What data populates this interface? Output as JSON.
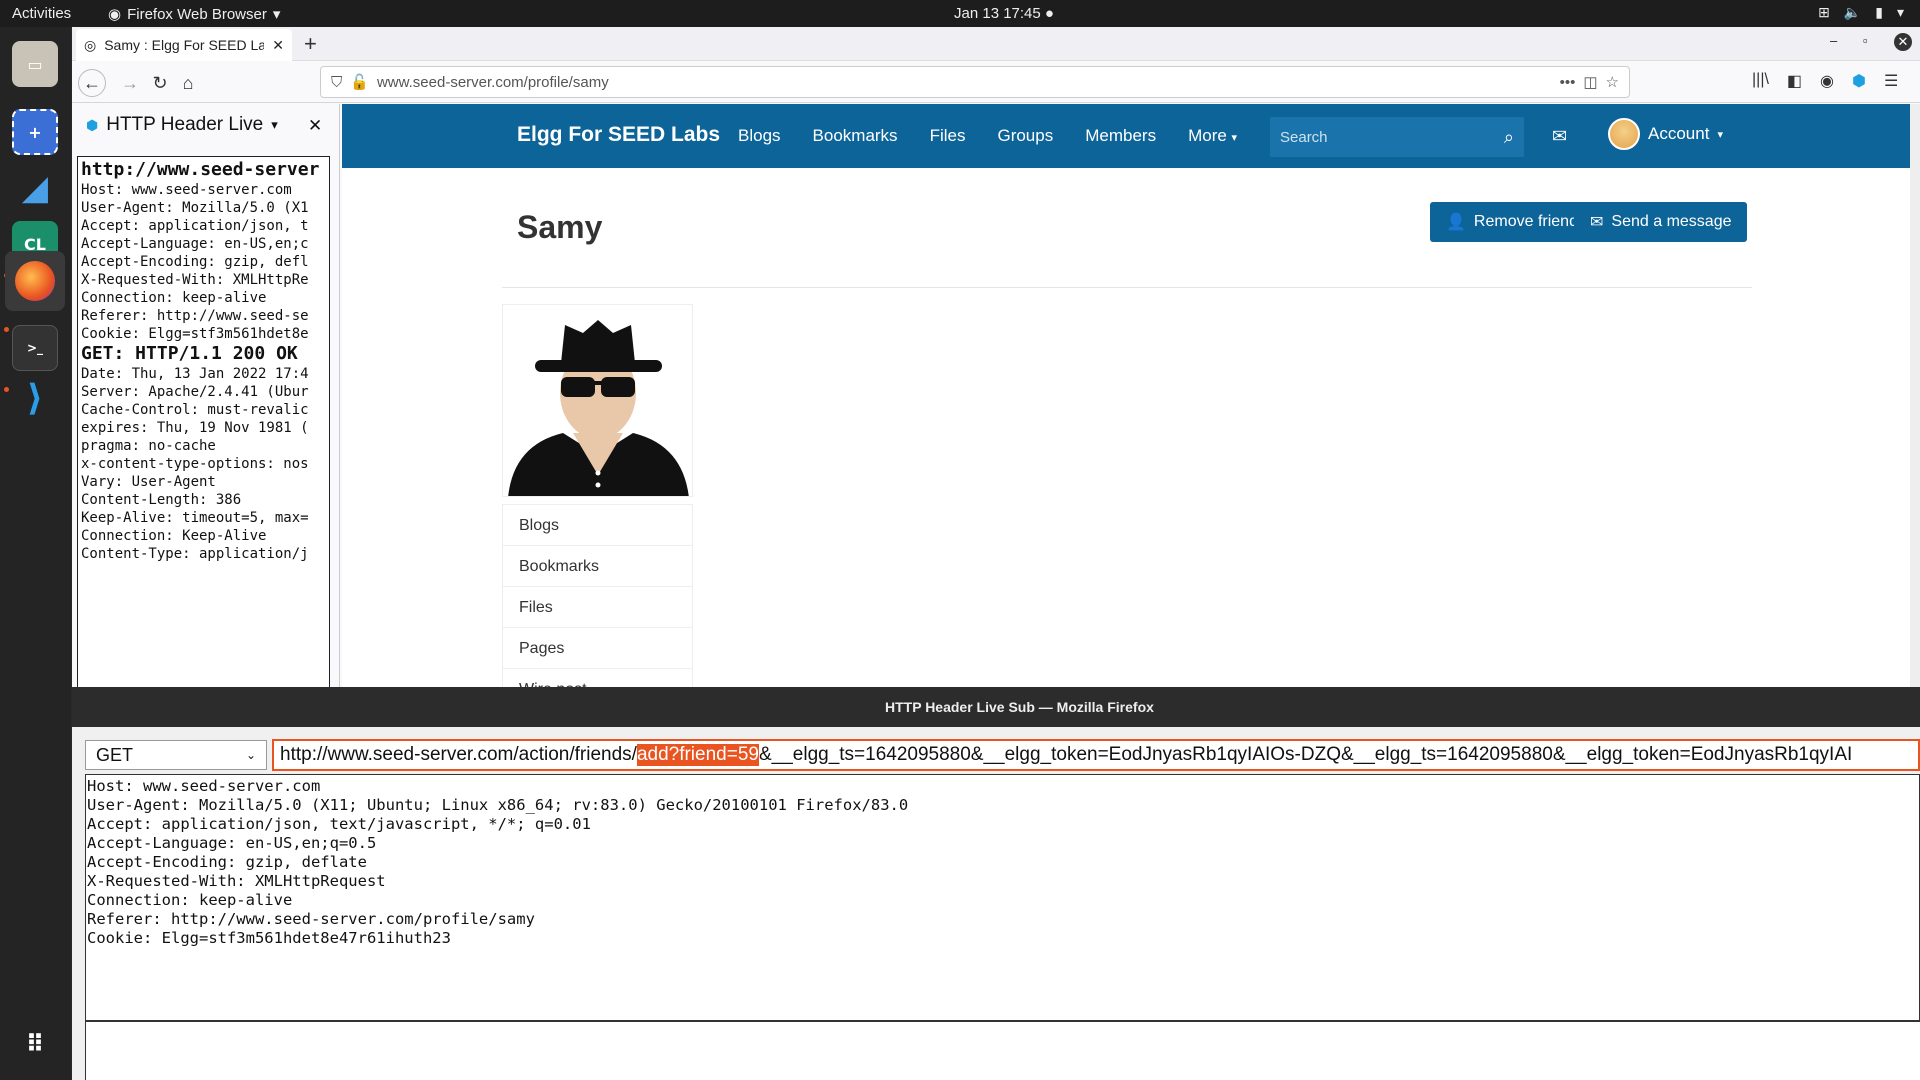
{
  "topbar": {
    "activities": "Activities",
    "app_name": "Firefox Web Browser",
    "clock": "Jan 13  17:45"
  },
  "tab": {
    "title": "Samy : Elgg For SEED Lab"
  },
  "urlbar": {
    "url": "www.seed-server.com/profile/samy"
  },
  "sidebar": {
    "title": "HTTP Header Live",
    "request_url": "http://www.seed-server",
    "request_lines": [
      "Host: www.seed-server.com",
      "User-Agent: Mozilla/5.0 (X1",
      "Accept: application/json, t",
      "Accept-Language: en-US,en;c",
      "Accept-Encoding: gzip, defl",
      "X-Requested-With: XMLHttpRe",
      "Connection: keep-alive",
      "Referer: http://www.seed-se",
      "Cookie: Elgg=stf3m561hdet8e"
    ],
    "status_line": "GET: HTTP/1.1 200 OK",
    "response_lines": [
      "Date: Thu, 13 Jan 2022 17:4",
      "Server: Apache/2.4.41 (Ubur",
      "Cache-Control: must-revalic",
      "expires: Thu, 19 Nov 1981 (",
      "pragma: no-cache",
      "x-content-type-options: nos",
      "Vary: User-Agent",
      "Content-Length: 386",
      "Keep-Alive: timeout=5, max=",
      "Connection: Keep-Alive",
      "Content-Type: application/j"
    ]
  },
  "elgg": {
    "brand": "Elgg For SEED Labs",
    "menu": [
      "Blogs",
      "Bookmarks",
      "Files",
      "Groups",
      "Members",
      "More"
    ],
    "search_placeholder": "Search",
    "account": "Account",
    "profile_name": "Samy",
    "remove_friend": "Remove friend",
    "send_message": "Send a message",
    "owner_menu": [
      "Blogs",
      "Bookmarks",
      "Files",
      "Pages",
      "Wire post"
    ]
  },
  "subwindow": {
    "title": "HTTP Header Live Sub — Mozilla Firefox",
    "method": "GET",
    "url_prefix": "http://www.seed-server.com/action/friends/",
    "url_highlight": "add?friend=59",
    "url_suffix": "&__elgg_ts=1642095880&__elgg_token=EodJnyasRb1qyIAIOs-DZQ&__elgg_ts=1642095880&__elgg_token=EodJnyasRb1qyIAI",
    "headers": "Host: www.seed-server.com\nUser-Agent: Mozilla/5.0 (X11; Ubuntu; Linux x86_64; rv:83.0) Gecko/20100101 Firefox/83.0\nAccept: application/json, text/javascript, */*; q=0.01\nAccept-Language: en-US,en;q=0.5\nAccept-Encoding: gzip, deflate\nX-Requested-With: XMLHttpRequest\nConnection: keep-alive\nReferer: http://www.seed-server.com/profile/samy\nCookie: Elgg=stf3m561hdet8e47r61ihuth23"
  },
  "colors": {
    "elgg_blue": "#0d6499",
    "accent": "#e95420"
  }
}
